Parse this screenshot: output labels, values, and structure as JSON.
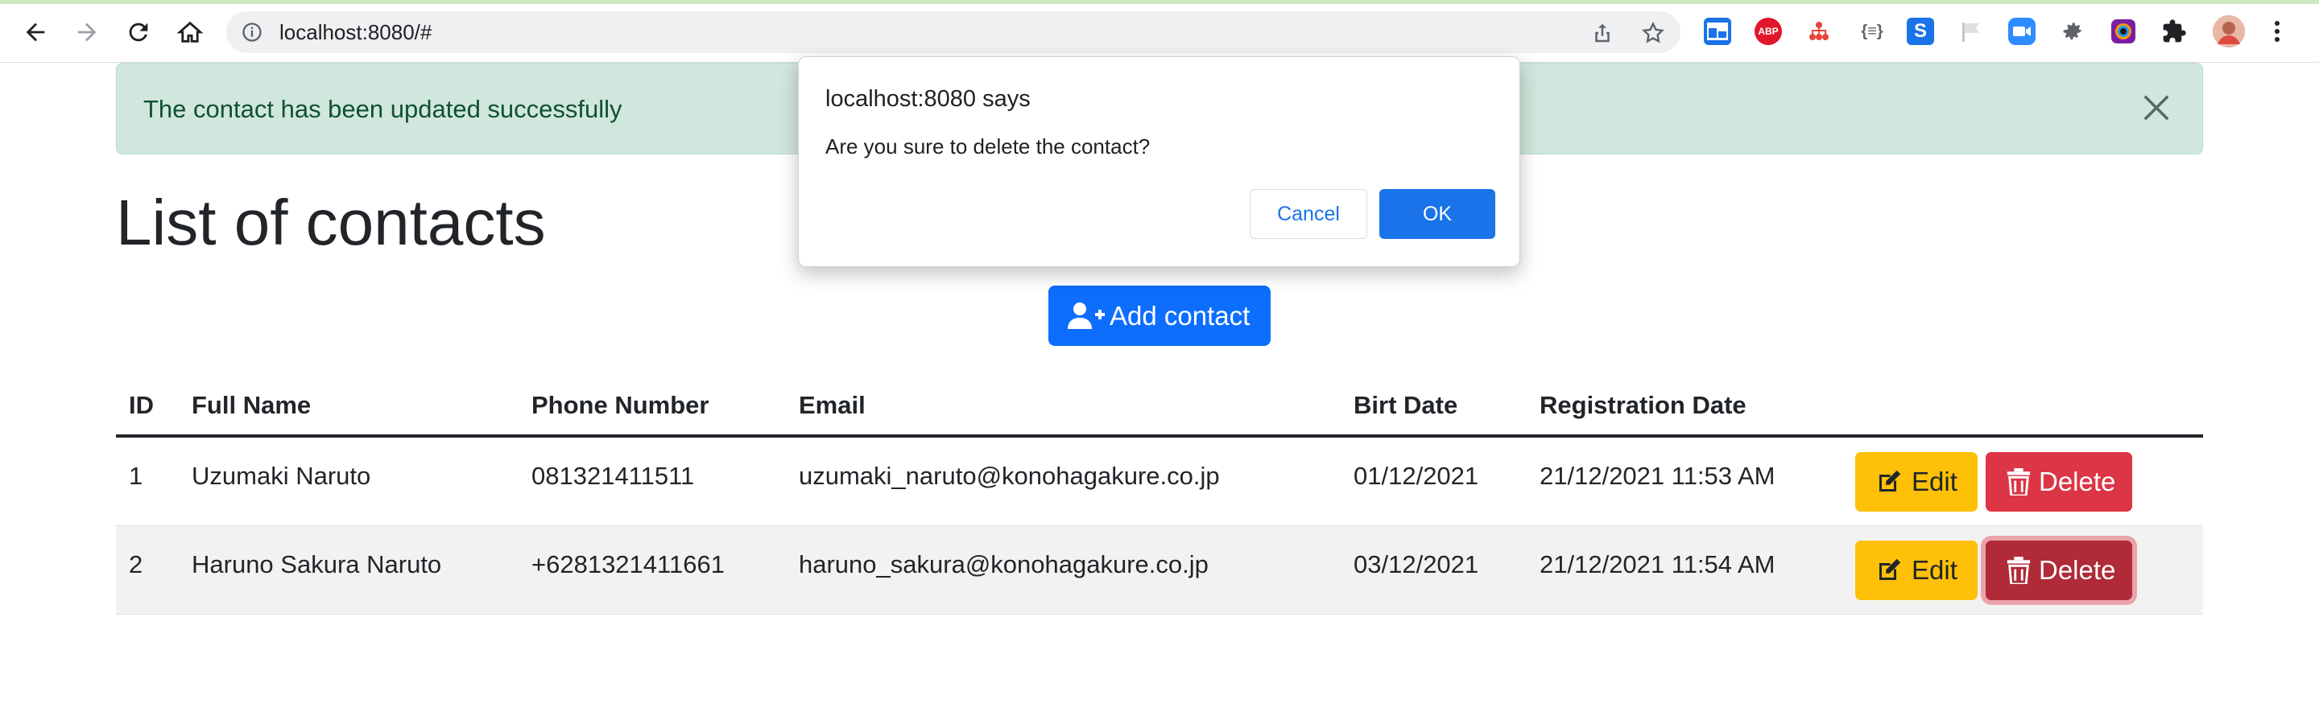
{
  "browser": {
    "url": "localhost:8080/#",
    "toolbar_icons": [
      "back-arrow-icon",
      "forward-arrow-icon",
      "reload-icon",
      "home-icon",
      "site-info-icon",
      "share-icon",
      "bookmark-star-icon"
    ],
    "extensions": [
      {
        "name": "window-extension-icon",
        "color": "#1a73e8"
      },
      {
        "name": "adblock-plus-icon",
        "label": "ABP",
        "color": "#e0172c"
      },
      {
        "name": "network-tree-icon",
        "color": "#e8453c"
      },
      {
        "name": "json-formatter-icon",
        "label": "{≡}",
        "color": "#5f6368"
      },
      {
        "name": "s-extension-icon",
        "color": "#1a73e8"
      },
      {
        "name": "gray-flag-extension-icon",
        "color": "#c7c7c7"
      },
      {
        "name": "zoom-extension-icon",
        "color": "#2d8cff"
      },
      {
        "name": "gear-extension-icon",
        "color": "#5f6368"
      },
      {
        "name": "color-picker-extension-icon",
        "color": "#7b1fa2"
      },
      {
        "name": "puzzle-piece-icon",
        "color": "#5f6368"
      },
      {
        "name": "profile-avatar",
        "color": "#c77c6e"
      },
      {
        "name": "more-vert-icon",
        "color": "#5f6368"
      }
    ]
  },
  "alert": {
    "message": "The contact has been updated successfully",
    "close_icon": "close-icon"
  },
  "page": {
    "title": "List of contacts",
    "add_button": "Add contact"
  },
  "table": {
    "headers": [
      "ID",
      "Full Name",
      "Phone Number",
      "Email",
      "Birt Date",
      "Registration Date"
    ],
    "rows": [
      {
        "id": "1",
        "full_name": "Uzumaki Naruto",
        "phone": "081321411511",
        "email": "uzumaki_naruto@konohagakure.co.jp",
        "birth_date": "01/12/2021",
        "registration_date": "21/12/2021 11:53 AM",
        "edit_label": "Edit",
        "delete_label": "Delete"
      },
      {
        "id": "2",
        "full_name": "Haruno Sakura Naruto",
        "phone": "+6281321411661",
        "email": "haruno_sakura@konohagakure.co.jp",
        "birth_date": "03/12/2021",
        "registration_date": "21/12/2021 11:54 AM",
        "edit_label": "Edit",
        "delete_label": "Delete"
      }
    ]
  },
  "dialog": {
    "title": "localhost:8080 says",
    "message": "Are you sure to delete the contact?",
    "cancel_label": "Cancel",
    "ok_label": "OK"
  },
  "colors": {
    "alert_bg": "#d1e7dd",
    "alert_text": "#0f5132",
    "primary": "#0d6efd",
    "warning": "#ffc107",
    "danger": "#dc3545",
    "danger_active": "#b02a37",
    "dialog_button": "#1a73e8"
  }
}
